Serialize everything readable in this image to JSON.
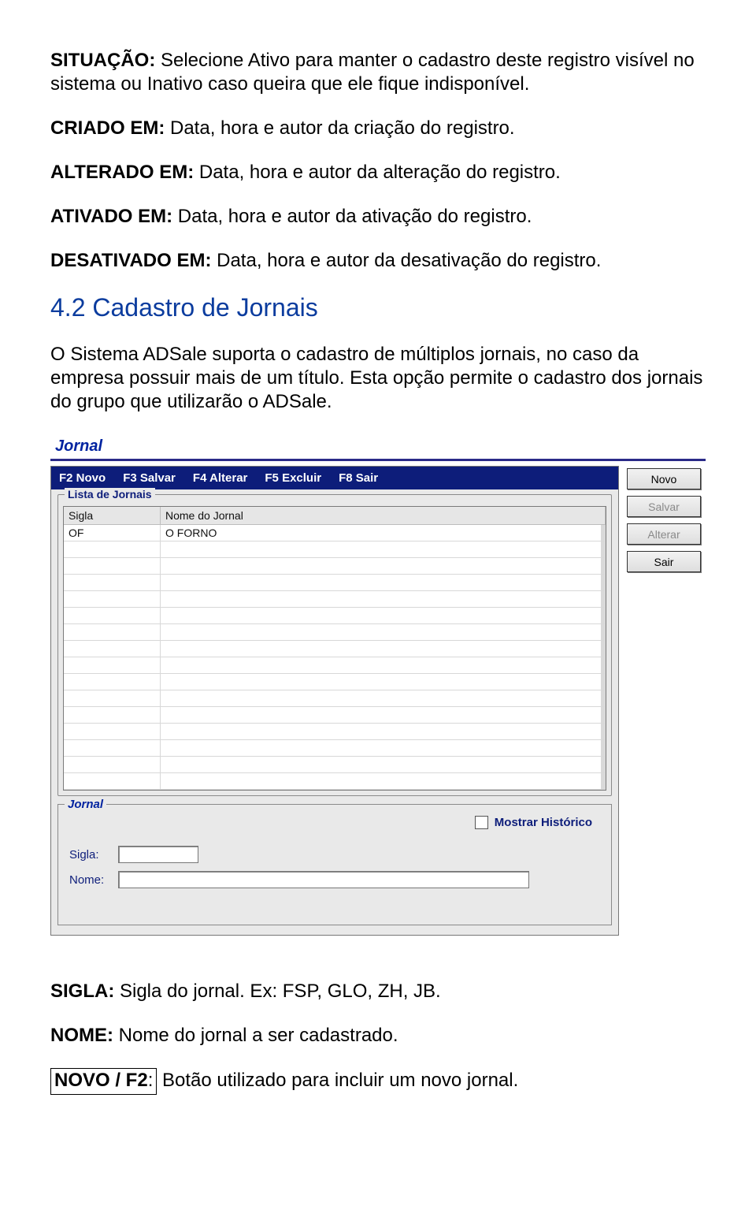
{
  "intro": {
    "p1": {
      "label": "SITUAÇÃO:",
      "text": " Selecione Ativo para manter o cadastro deste registro visível no sistema ou Inativo caso queira que ele fique indisponível."
    },
    "p2": {
      "label": "CRIADO EM:",
      "text": " Data, hora e autor da criação do registro."
    },
    "p3": {
      "label": "ALTERADO EM:",
      "text": " Data, hora e autor da alteração do registro."
    },
    "p4": {
      "label": "ATIVADO EM:",
      "text": " Data, hora e autor da ativação do registro."
    },
    "p5": {
      "label": "DESATIVADO EM:",
      "text": " Data, hora e autor da desativação do registro."
    }
  },
  "heading": "4.2 Cadastro de Jornais",
  "desc": "O Sistema ADSale suporta o cadastro de múltiplos jornais, no caso da empresa possuir mais de um título. Esta opção permite o cadastro dos jornais do grupo que utilizarão o ADSale.",
  "window": {
    "title": "Jornal",
    "menubar": [
      "F2 Novo",
      "F3 Salvar",
      "F4 Alterar",
      "F5 Excluir",
      "F8 Sair"
    ],
    "list_legend": "Lista de Jornais",
    "columns": [
      "Sigla",
      "Nome do Jornal"
    ],
    "rows": [
      [
        "OF",
        "O FORNO"
      ]
    ],
    "form_legend": "Jornal",
    "show_history": "Mostrar Histórico",
    "field_sigla": "Sigla:",
    "field_nome": "Nome:",
    "buttons": {
      "novo": "Novo",
      "salvar": "Salvar",
      "alterar": "Alterar",
      "sair": "Sair"
    },
    "blank_rows": 15
  },
  "after": {
    "sigla": {
      "label": "SIGLA:",
      "text": " Sigla do jornal. Ex: FSP, GLO, ZH, JB."
    },
    "nome": {
      "label": "NOME:",
      "text": " Nome do jornal a ser cadastrado."
    },
    "novo": {
      "label": "NOVO / F2",
      "suffix": ":",
      "text": " Botão utilizado para incluir um novo jornal."
    }
  }
}
